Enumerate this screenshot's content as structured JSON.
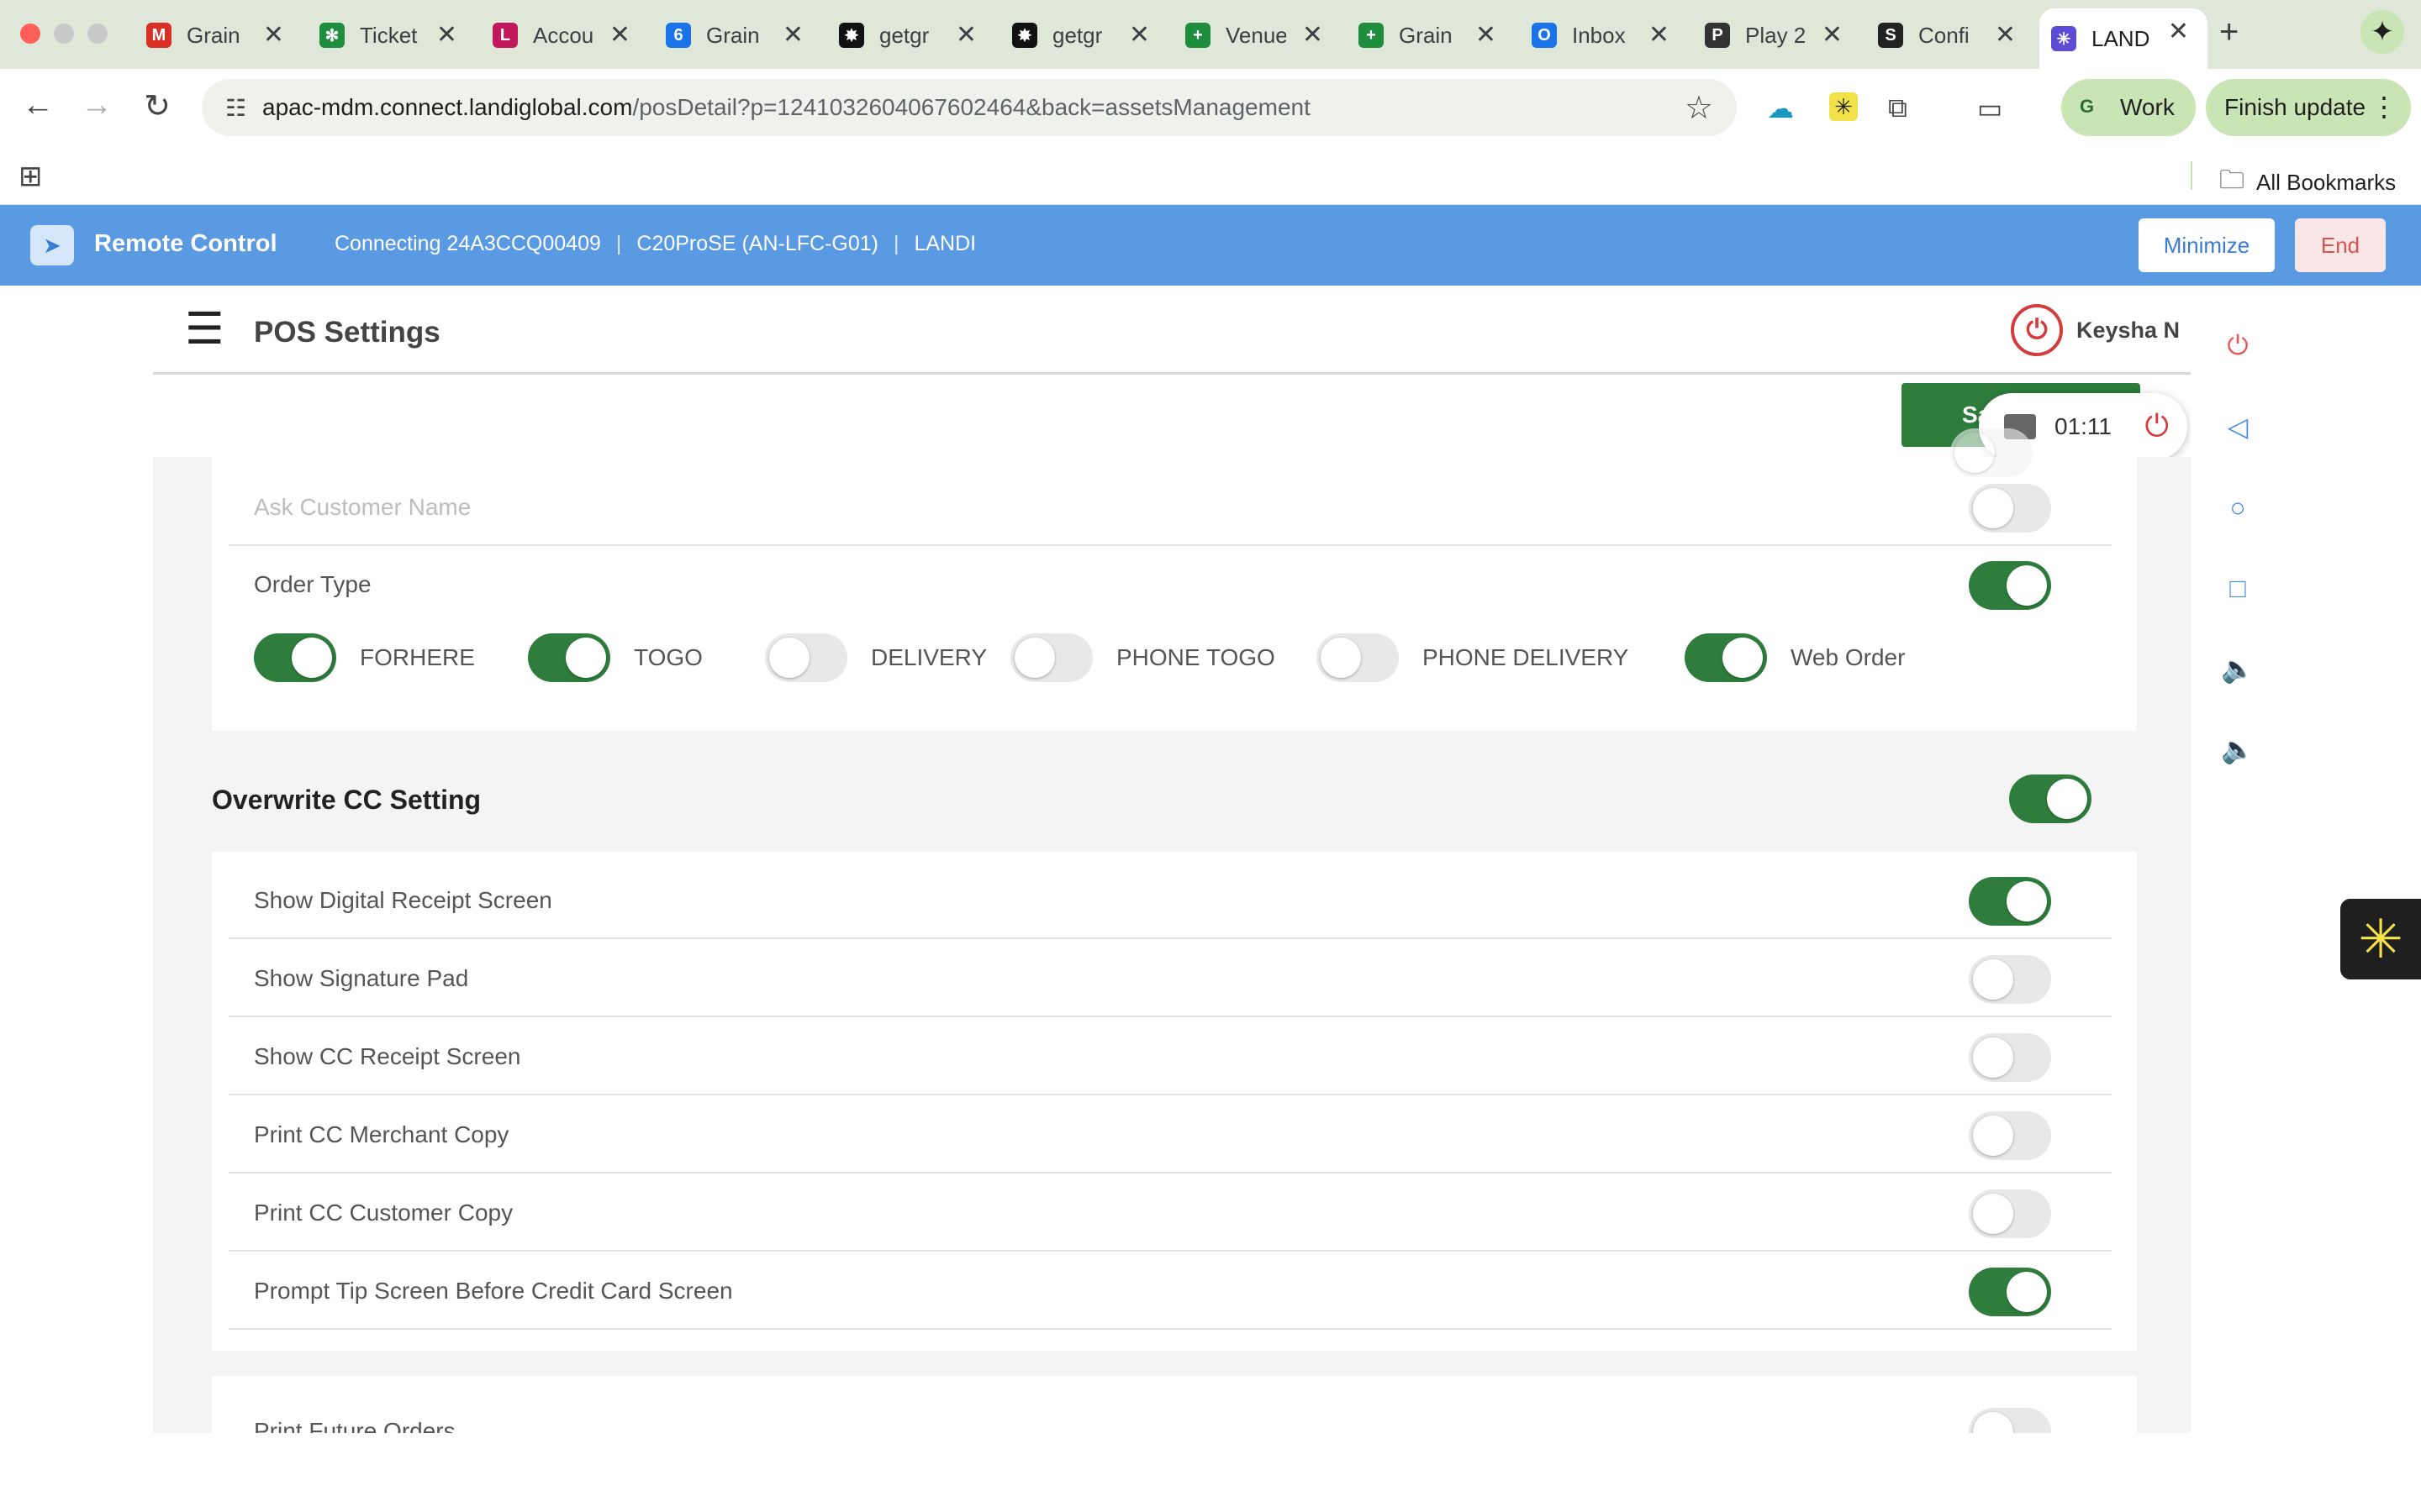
{
  "browser": {
    "tabs": [
      {
        "title": "Grain",
        "icon": "gmail-icon",
        "glyph": "M",
        "color": "#d93025",
        "active": false
      },
      {
        "title": "Ticket",
        "icon": "gear-icon",
        "glyph": "✻",
        "color": "#1e8e3e",
        "active": false
      },
      {
        "title": "Accou",
        "icon": "lingo-icon",
        "glyph": "L",
        "color": "#c2185b",
        "active": false
      },
      {
        "title": "Grain",
        "icon": "calendar-icon",
        "glyph": "6",
        "color": "#1a73e8",
        "active": false
      },
      {
        "title": "getgr",
        "icon": "getgrain-icon",
        "glyph": "✸",
        "color": "#111111",
        "active": false
      },
      {
        "title": "getgr",
        "icon": "getgrain-icon",
        "glyph": "✸",
        "color": "#111111",
        "active": false
      },
      {
        "title": "Venue",
        "icon": "sheets-icon",
        "glyph": "+",
        "color": "#1e8e3e",
        "active": false
      },
      {
        "title": "Grain",
        "icon": "sheets-icon",
        "glyph": "+",
        "color": "#1e8e3e",
        "active": false
      },
      {
        "title": "Inbox",
        "icon": "outlook-icon",
        "glyph": "O",
        "color": "#1a73e8",
        "active": false
      },
      {
        "title": "Play 2",
        "icon": "play-icon",
        "glyph": "P",
        "color": "#333333",
        "active": false
      },
      {
        "title": "Confi",
        "icon": "confluence-icon",
        "glyph": "S",
        "color": "#222222",
        "active": false
      },
      {
        "title": "LAND",
        "icon": "landi-icon",
        "glyph": "✳",
        "color": "#5b4bd5",
        "active": true
      }
    ],
    "close_glyph": "✕",
    "new_tab_glyph": "+",
    "url_host": "apac-mdm.connect.landiglobal.com",
    "url_path": "/posDetail?p=1241032604067602464&back=assetsManagement",
    "profile_label": "Work",
    "update_label": "Finish update",
    "bookmarks_label": "All Bookmarks"
  },
  "remote": {
    "title": "Remote Control",
    "connecting": "Connecting 24A3CCQ00409",
    "model": "C20ProSE (AN-LFC-G01)",
    "brand": "LANDI",
    "separator": "|",
    "minimize_label": "Minimize",
    "end_label": "End",
    "timer": "01:11"
  },
  "pos": {
    "title": "POS Settings",
    "user": "Keysha N",
    "save_label": "Sav",
    "rows_top": [
      {
        "label": "Ask Customer Name",
        "on": false,
        "faded": true
      },
      {
        "label": "Order Type",
        "on": true,
        "faded": false
      }
    ],
    "order_types": [
      {
        "label": "FORHERE",
        "on": true
      },
      {
        "label": "TOGO",
        "on": true
      },
      {
        "label": "DELIVERY",
        "on": false
      },
      {
        "label": "PHONE TOGO",
        "on": false
      },
      {
        "label": "PHONE DELIVERY",
        "on": false
      },
      {
        "label": "Web Order",
        "on": true
      }
    ],
    "cc_section": {
      "title": "Overwrite CC Setting",
      "on": true,
      "rows": [
        {
          "label": "Show Digital Receipt Screen",
          "on": true
        },
        {
          "label": "Show Signature Pad",
          "on": false
        },
        {
          "label": "Show CC Receipt Screen",
          "on": false
        },
        {
          "label": "Print CC Merchant Copy",
          "on": false
        },
        {
          "label": "Print CC Customer Copy",
          "on": false
        },
        {
          "label": "Prompt Tip Screen Before Credit Card Screen",
          "on": true
        }
      ]
    },
    "future_orders": {
      "label": "Print Future Orders",
      "on": false
    }
  },
  "colors": {
    "toggle_on": "#2e7d3c",
    "remote_bar": "#5a9ae3",
    "danger": "#d43b3b"
  }
}
